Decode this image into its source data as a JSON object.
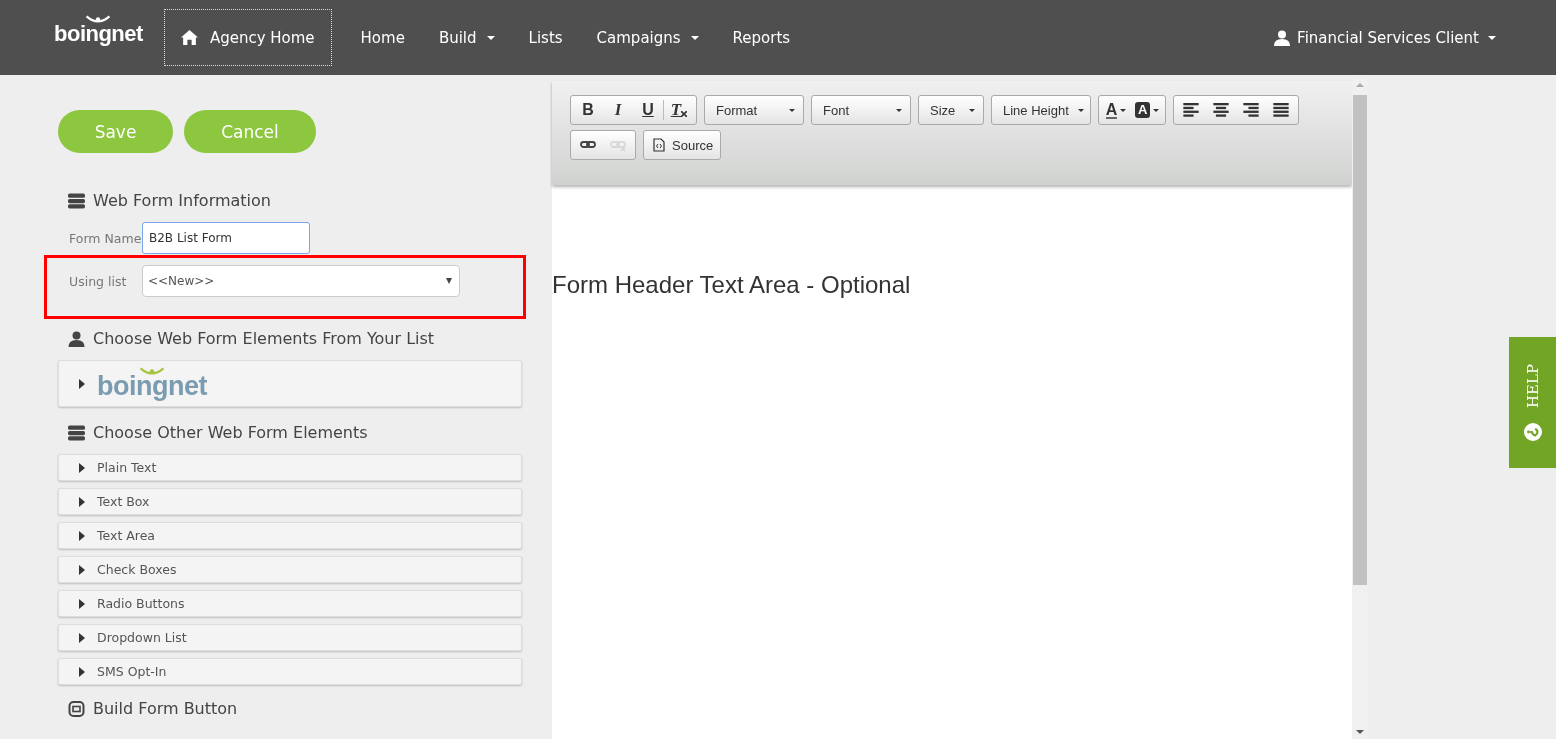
{
  "navbar": {
    "logo": "boingnet",
    "items": [
      {
        "label": "Agency Home",
        "kind": "home",
        "selected": true
      },
      {
        "label": "Home",
        "kind": "link",
        "selected": false
      },
      {
        "label": "Build",
        "kind": "dropdown",
        "selected": false
      },
      {
        "label": "Lists",
        "kind": "link",
        "selected": false
      },
      {
        "label": "Campaigns",
        "kind": "dropdown",
        "selected": false
      },
      {
        "label": "Reports",
        "kind": "link",
        "selected": false
      }
    ],
    "user": "Financial Services Client"
  },
  "actions": [
    "Save",
    "Cancel"
  ],
  "web_form_information": {
    "title": "Web Form Information",
    "form_name_label": "Form Name",
    "form_name_value": "B2B List Form",
    "using_list_label": "Using list",
    "using_list_value": "<<New>>"
  },
  "list_elements": {
    "title": "Choose Web Form Elements From Your List",
    "logo": "boingnet"
  },
  "other_elements": {
    "title": "Choose Other Web Form Elements",
    "items": [
      "Plain Text",
      "Text Box",
      "Text Area",
      "Check Boxes",
      "Radio Buttons",
      "Dropdown List",
      "SMS Opt-In"
    ]
  },
  "build_form_button": {
    "title": "Build Form Button"
  },
  "editor": {
    "toolbar_rows": [
      [
        {
          "kind": "buttons",
          "items": [
            {
              "kind": "bold",
              "glyph": "B",
              "disabled": false
            },
            {
              "kind": "italic",
              "glyph": "I",
              "disabled": false
            },
            {
              "kind": "underline",
              "glyph": "U",
              "disabled": false
            },
            {
              "kind": "clear",
              "glyph": "T",
              "disabled": false
            }
          ]
        },
        {
          "kind": "combo",
          "label": "Format"
        },
        {
          "kind": "combo",
          "label": "Font"
        },
        {
          "kind": "combo",
          "label": "Size"
        },
        {
          "kind": "combo",
          "label": "Line Height"
        },
        {
          "kind": "buttons",
          "items": [
            {
              "kind": "text-color",
              "glyph": "A",
              "disabled": false
            },
            {
              "kind": "bg-color",
              "glyph": "A",
              "disabled": false
            }
          ]
        },
        {
          "kind": "buttons",
          "items": [
            {
              "kind": "align-left",
              "disabled": false
            },
            {
              "kind": "align-center",
              "disabled": false
            },
            {
              "kind": "align-right",
              "disabled": false
            },
            {
              "kind": "justify",
              "disabled": false
            }
          ]
        }
      ],
      [
        {
          "kind": "buttons",
          "items": [
            {
              "kind": "link",
              "disabled": false
            },
            {
              "kind": "unlink",
              "disabled": true
            }
          ]
        },
        {
          "kind": "source",
          "label": "Source"
        }
      ]
    ],
    "content": "Form Header Text Area - Optional"
  },
  "help_tab": "HELP"
}
